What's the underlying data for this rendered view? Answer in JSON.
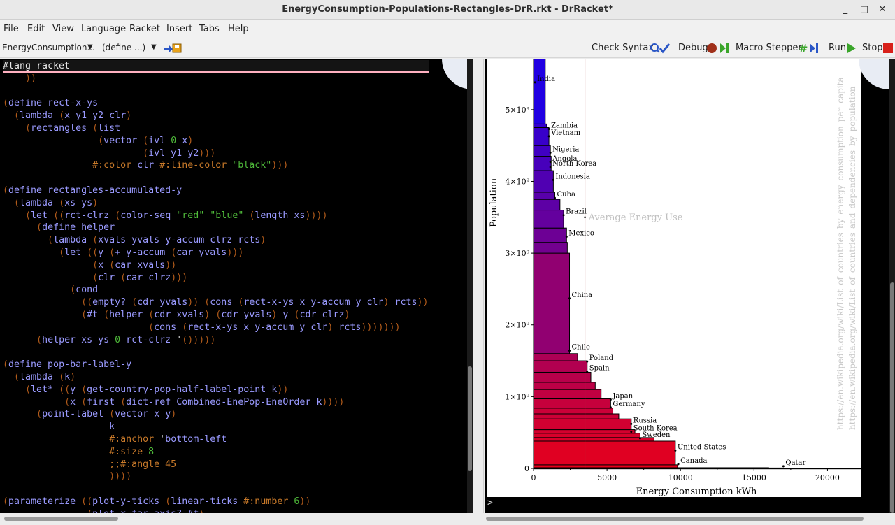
{
  "window": {
    "title": "EnergyConsumption-Populations-Rectangles-DrR.rkt - DrRacket*",
    "minimize": "_",
    "maximize": "□",
    "close": "✕"
  },
  "menu": [
    "File",
    "Edit",
    "View",
    "Language",
    "Racket",
    "Insert",
    "Tabs",
    "Help"
  ],
  "toolbar": {
    "file_dropdown": "EnergyConsumption...",
    "define_dropdown": "(define ...)",
    "check_syntax": "Check Syntax",
    "debug": "Debug",
    "macro_stepper": "Macro Stepper",
    "run": "Run",
    "stop": "Stop"
  },
  "editor": {
    "lines": [
      "#lang racket",
      "    ))",
      "",
      "(define rect-x-ys",
      "  (lambda (x y1 y2 clr)",
      "    (rectangles (list",
      "                 (vector (ivl 0 x)",
      "                         (ivl y1 y2)))",
      "                #:color clr #:line-color \"black\")))",
      "",
      "(define rectangles-accumulated-y",
      "  (lambda (xs ys)",
      "    (let ((rct-clrz (color-seq \"red\" \"blue\" (length xs))))",
      "      (define helper",
      "        (lambda (xvals yvals y-accum clrz rcts)",
      "          (let ((y (+ y-accum (car yvals)))",
      "                (x (car xvals))",
      "                (clr (car clrz)))",
      "            (cond",
      "              ((empty? (cdr yvals)) (cons (rect-x-ys x y-accum y clr) rcts))",
      "              (#t (helper (cdr xvals) (cdr yvals) y (cdr clrz)",
      "                          (cons (rect-x-ys x y-accum y clr) rcts)))))))",
      "      (helper xs ys 0 rct-clrz '()))))",
      "",
      "(define pop-bar-label-y",
      "  (lambda (k)",
      "    (let* ((y (get-country-pop-half-label-point k))",
      "           (x (first (dict-ref Combined-EnePop-EneOrder k))))",
      "      (point-label (vector x y)",
      "                   k",
      "                   #:anchor 'bottom-left",
      "                   #:size 8",
      "                   ;;#:angle 45",
      "                   ))))",
      "",
      "(parameterize ((plot-y-ticks (linear-ticks #:number 6))",
      "               (plot-x-far-axis? #f)"
    ]
  },
  "chart_data": {
    "type": "bar",
    "title": "",
    "xlabel": "Energy Consumption kWh",
    "ylabel": "Population",
    "xlim": [
      0,
      22500
    ],
    "ylim": [
      0,
      5700000000
    ],
    "x_ticks": [
      "0",
      "5000",
      "10000",
      "15000",
      "20000"
    ],
    "y_ticks": [
      "0",
      "1×10⁹",
      "2×10⁹",
      "3×10⁹",
      "4×10⁹",
      "5×10⁹"
    ],
    "average_line": {
      "label": "Average Energy Use",
      "value": 3500
    },
    "source_text": [
      "https://en.wikipedia.org/wiki/List_of_countries_by_energy_consumption_per_capita",
      "https://en.wikipedia.org/wiki/List_of_countries_and_dependencies_by_population"
    ],
    "labels": [
      {
        "name": "India",
        "x": 100,
        "y": 5380000000
      },
      {
        "name": "Zambia",
        "x": 1050,
        "y": 4730000000
      },
      {
        "name": "Vietnam",
        "x": 1050,
        "y": 4630000000
      },
      {
        "name": "Nigeria",
        "x": 1150,
        "y": 4400000000
      },
      {
        "name": "Angola",
        "x": 1150,
        "y": 4270000000
      },
      {
        "name": "North Korea",
        "x": 1150,
        "y": 4200000000
      },
      {
        "name": "Indonesia",
        "x": 1350,
        "y": 4020000000
      },
      {
        "name": "Cuba",
        "x": 1450,
        "y": 3770000000
      },
      {
        "name": "Brazil",
        "x": 2050,
        "y": 3530000000
      },
      {
        "name": "Mexico",
        "x": 2250,
        "y": 3230000000
      },
      {
        "name": "China",
        "x": 2450,
        "y": 2370000000
      },
      {
        "name": "Chile",
        "x": 2450,
        "y": 1640000000
      },
      {
        "name": "Poland",
        "x": 3650,
        "y": 1490000000
      },
      {
        "name": "Spain",
        "x": 3650,
        "y": 1350000000
      },
      {
        "name": "Japan",
        "x": 5250,
        "y": 960000000
      },
      {
        "name": "Germany",
        "x": 5250,
        "y": 850000000
      },
      {
        "name": "Russia",
        "x": 6650,
        "y": 620000000
      },
      {
        "name": "South Korea",
        "x": 6650,
        "y": 510000000
      },
      {
        "name": "Sweden",
        "x": 7250,
        "y": 420000000
      },
      {
        "name": "United States",
        "x": 9650,
        "y": 250000000
      },
      {
        "name": "Canada",
        "x": 9850,
        "y": 60000000
      },
      {
        "name": "Qatar",
        "x": 17000,
        "y": 30000000
      }
    ],
    "bars": [
      {
        "x": 25000,
        "y0": 0,
        "y1": 3000000
      },
      {
        "x": 17000,
        "y0": 3000000,
        "y1": 6000000
      },
      {
        "x": 16000,
        "y0": 6000000,
        "y1": 10000000
      },
      {
        "x": 9800,
        "y0": 10000000,
        "y1": 50000000
      },
      {
        "x": 9650,
        "y0": 50000000,
        "y1": 380000000
      },
      {
        "x": 8200,
        "y0": 380000000,
        "y1": 430000000
      },
      {
        "x": 7250,
        "y0": 430000000,
        "y1": 490000000
      },
      {
        "x": 6900,
        "y0": 490000000,
        "y1": 540000000
      },
      {
        "x": 6650,
        "y0": 540000000,
        "y1": 690000000
      },
      {
        "x": 5800,
        "y0": 690000000,
        "y1": 760000000
      },
      {
        "x": 5400,
        "y0": 760000000,
        "y1": 840000000
      },
      {
        "x": 5250,
        "y0": 840000000,
        "y1": 970000000
      },
      {
        "x": 4600,
        "y0": 970000000,
        "y1": 1100000000
      },
      {
        "x": 4200,
        "y0": 1100000000,
        "y1": 1200000000
      },
      {
        "x": 3900,
        "y0": 1200000000,
        "y1": 1340000000
      },
      {
        "x": 3650,
        "y0": 1340000000,
        "y1": 1500000000
      },
      {
        "x": 3000,
        "y0": 1500000000,
        "y1": 1600000000
      },
      {
        "x": 2450,
        "y0": 1600000000,
        "y1": 3000000000
      },
      {
        "x": 2300,
        "y0": 3000000000,
        "y1": 3150000000
      },
      {
        "x": 2250,
        "y0": 3150000000,
        "y1": 3350000000
      },
      {
        "x": 2050,
        "y0": 3350000000,
        "y1": 3600000000
      },
      {
        "x": 1800,
        "y0": 3600000000,
        "y1": 3750000000
      },
      {
        "x": 1450,
        "y0": 3750000000,
        "y1": 3850000000
      },
      {
        "x": 1350,
        "y0": 3850000000,
        "y1": 4150000000
      },
      {
        "x": 1200,
        "y0": 4150000000,
        "y1": 4350000000
      },
      {
        "x": 1150,
        "y0": 4350000000,
        "y1": 4500000000
      },
      {
        "x": 1050,
        "y0": 4500000000,
        "y1": 4750000000
      },
      {
        "x": 900,
        "y0": 4750000000,
        "y1": 4800000000
      },
      {
        "x": 800,
        "y0": 4800000000,
        "y1": 5750000000
      }
    ],
    "colors": {
      "start": "#e8001a",
      "end": "#1a00e8",
      "avg_line": "#a04040",
      "grid_text": "#c0c0c0"
    }
  }
}
